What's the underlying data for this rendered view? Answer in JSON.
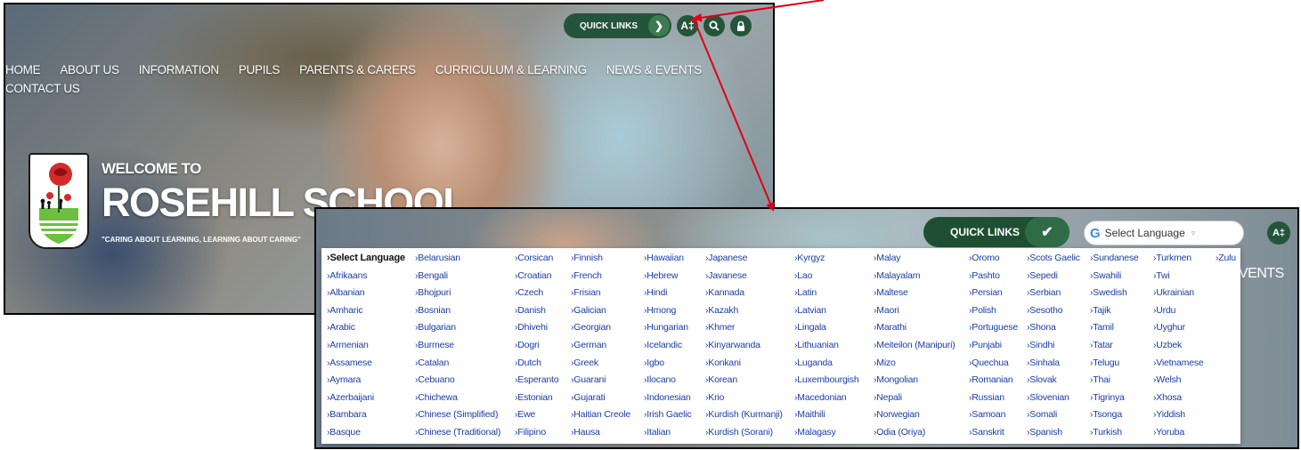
{
  "accent": "#24543a",
  "arrow_color": "#e0001a",
  "screen1": {
    "quick_links": "QUICK LINKS",
    "nav": [
      "HOME",
      "ABOUT US",
      "INFORMATION",
      "PUPILS",
      "PARENTS & CARERS",
      "CURRICULUM & LEARNING",
      "NEWS & EVENTS",
      "CONTACT US"
    ],
    "welcome": "WELCOME TO",
    "school_name": "ROSEHILL SCHOOL",
    "motto": "\"CARING ABOUT LEARNING, LEARNING ABOUT CARING\""
  },
  "screen2": {
    "quick_links": "QUICK LINKS",
    "select_placeholder": "Select Language",
    "nav_fragment": "VENTS",
    "languages": [
      [
        "Select Language",
        "Afrikaans",
        "Albanian",
        "Amharic",
        "Arabic",
        "Armenian",
        "Assamese",
        "Aymara",
        "Azerbaijani",
        "Bambara",
        "Basque"
      ],
      [
        "Belarusian",
        "Bengali",
        "Bhojpuri",
        "Bosnian",
        "Bulgarian",
        "Burmese",
        "Catalan",
        "Cebuano",
        "Chichewa",
        "Chinese (Simplified)",
        "Chinese (Traditional)"
      ],
      [
        "Corsican",
        "Croatian",
        "Czech",
        "Danish",
        "Dhivehi",
        "Dogri",
        "Dutch",
        "Esperanto",
        "Estonian",
        "Ewe",
        "Filipino"
      ],
      [
        "Finnish",
        "French",
        "Frisian",
        "Galician",
        "Georgian",
        "German",
        "Greek",
        "Guarani",
        "Gujarati",
        "Haitian Creole",
        "Hausa"
      ],
      [
        "Hawaiian",
        "Hebrew",
        "Hindi",
        "Hmong",
        "Hungarian",
        "Icelandic",
        "Igbo",
        "Ilocano",
        "Indonesian",
        "Irish Gaelic",
        "Italian"
      ],
      [
        "Japanese",
        "Javanese",
        "Kannada",
        "Kazakh",
        "Khmer",
        "Kinyarwanda",
        "Konkani",
        "Korean",
        "Krio",
        "Kurdish (Kurmanji)",
        "Kurdish (Sorani)"
      ],
      [
        "Kyrgyz",
        "Lao",
        "Latin",
        "Latvian",
        "Lingala",
        "Lithuanian",
        "Luganda",
        "Luxembourgish",
        "Macedonian",
        "Maithili",
        "Malagasy"
      ],
      [
        "Malay",
        "Malayalam",
        "Maltese",
        "Maori",
        "Marathi",
        "Meiteilon (Manipuri)",
        "Mizo",
        "Mongolian",
        "Nepali",
        "Norwegian",
        "Odia (Oriya)"
      ],
      [
        "Oromo",
        "Pashto",
        "Persian",
        "Polish",
        "Portuguese",
        "Punjabi",
        "Quechua",
        "Romanian",
        "Russian",
        "Samoan",
        "Sanskrit"
      ],
      [
        "Scots Gaelic",
        "Sepedi",
        "Serbian",
        "Sesotho",
        "Shona",
        "Sindhi",
        "Sinhala",
        "Slovak",
        "Slovenian",
        "Somali",
        "Spanish"
      ],
      [
        "Sundanese",
        "Swahili",
        "Swedish",
        "Tajik",
        "Tamil",
        "Tatar",
        "Telugu",
        "Thai",
        "Tigrinya",
        "Tsonga",
        "Turkish"
      ],
      [
        "Turkmen",
        "Twi",
        "Ukrainian",
        "Urdu",
        "Uyghur",
        "Uzbek",
        "Vietnamese",
        "Welsh",
        "Xhosa",
        "Yiddish",
        "Yoruba"
      ],
      [
        "Zulu"
      ]
    ]
  }
}
